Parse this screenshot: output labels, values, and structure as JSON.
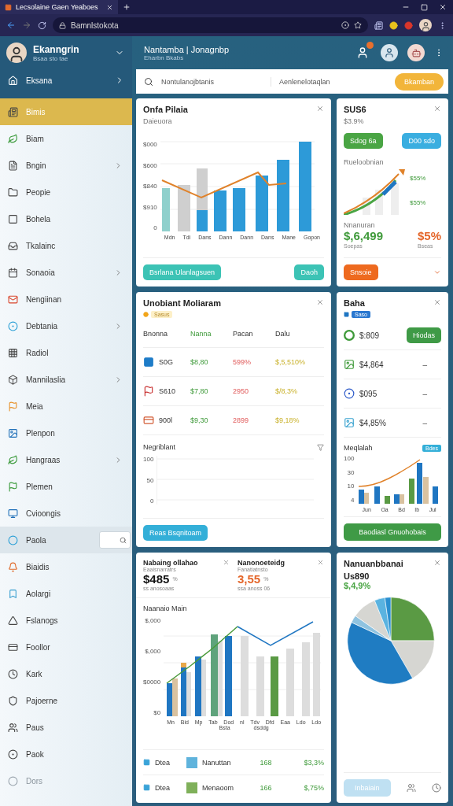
{
  "browser": {
    "tab_title": "Lecsolaine Gaen Yeaboes",
    "address": "Bamnlstokota"
  },
  "profile": {
    "name": "Ekanngrin",
    "subtitle": "Bsaa sto tae"
  },
  "sidebar": {
    "top_item": {
      "label": "Eksana",
      "expandable": true
    },
    "items": [
      {
        "label": "Bimis",
        "expandable": false,
        "selected": true
      },
      {
        "label": "Biam",
        "expandable": false,
        "selected": false
      },
      {
        "label": "Bngin",
        "expandable": true,
        "selected": false
      },
      {
        "label": "Peopie",
        "expandable": false,
        "selected": false
      },
      {
        "label": "Bohela",
        "expandable": false,
        "selected": false
      },
      {
        "label": "Tkalainc",
        "expandable": false,
        "selected": false
      },
      {
        "label": "Sonaoia",
        "expandable": true,
        "selected": false
      },
      {
        "label": "Nengiinan",
        "expandable": false,
        "selected": false
      },
      {
        "label": "Debtania",
        "expandable": true,
        "selected": false
      },
      {
        "label": "Radiol",
        "expandable": false,
        "selected": false
      },
      {
        "label": "Mannilaslia",
        "expandable": true,
        "selected": false
      },
      {
        "label": "Meia",
        "expandable": false,
        "selected": false
      },
      {
        "label": "Plenpon",
        "expandable": false,
        "selected": false
      },
      {
        "label": "Hangraas",
        "expandable": true,
        "selected": false
      },
      {
        "label": "Plemen",
        "expandable": false,
        "selected": false
      },
      {
        "label": "Cvioongis",
        "expandable": false,
        "selected": false
      },
      {
        "label": "Paola",
        "expandable": false,
        "selected": false,
        "hovered": true
      },
      {
        "label": "Biaidis",
        "expandable": false,
        "selected": false
      },
      {
        "label": "Aolargi",
        "expandable": false,
        "selected": false
      },
      {
        "label": "Fslanogs",
        "expandable": false,
        "selected": false
      },
      {
        "label": "Foollor",
        "expandable": false,
        "selected": false
      },
      {
        "label": "Kark",
        "expandable": false,
        "selected": false
      },
      {
        "label": "Pajoerne",
        "expandable": false,
        "selected": false
      },
      {
        "label": "Paus",
        "expandable": false,
        "selected": false
      },
      {
        "label": "Paok",
        "expandable": false,
        "selected": false
      },
      {
        "label": "Dors",
        "expandable": false,
        "selected": false,
        "disabled": true
      }
    ]
  },
  "header": {
    "title": "Nantamba | Jonagnbp",
    "subtitle": "Eharbn Bkabs"
  },
  "search": {
    "placeholder": "Nontulanojbtanis",
    "filter_placeholder": "Aenlenelotaqlan",
    "button": "Bkamban"
  },
  "sales_card": {
    "title": "Onfa Pilaia",
    "subtitle": "Daieuora",
    "y_labels": [
      "$000",
      "$600",
      "$840",
      "$910",
      "0"
    ],
    "x_labels": [
      "Mdn",
      "Tdi",
      "Dans",
      "Dann",
      "Dann",
      "Dans",
      "Mane",
      "Gopon"
    ],
    "buttons": [
      "Bsrlana Ulanlagsuen",
      "Daoh"
    ]
  },
  "growth_card": {
    "title": "SUS6",
    "subtitle": "$3.9%",
    "buttons": [
      "Sdog 6a",
      "D00 sdo"
    ],
    "chart_title": "Rueloobnian",
    "legend": [
      "$55%",
      "$55%"
    ],
    "stat_title": "Nnanuran",
    "stats": [
      {
        "value": "$,6,499",
        "caption": "Soepas",
        "kind": "up"
      },
      {
        "value": "$5%",
        "caption": "Bseas",
        "kind": "down"
      }
    ],
    "button": "Snsoie"
  },
  "table_card": {
    "title": "Unobiant Moliaram",
    "badge": "Sasus",
    "columns": [
      "Bnonna",
      "Nanna",
      "Pacan",
      "Dalu"
    ],
    "rows": [
      {
        "cells": [
          "S0G",
          "$8,80",
          "599%",
          "$,5,510%"
        ]
      },
      {
        "cells": [
          "S610",
          "$7,80",
          "2950",
          "$/8,3%"
        ]
      },
      {
        "cells": [
          "900l",
          "$9,30",
          "2899",
          "$9,18%"
        ]
      }
    ],
    "section_title": "Negriblant",
    "y_labels": [
      "100",
      "50",
      "0"
    ],
    "button": "Reas Bsqnitoam"
  },
  "list_card": {
    "title": "Baha",
    "badge": "Saso",
    "items": [
      {
        "value": "$:809",
        "action": "Hiodas"
      },
      {
        "value": "$4,864",
        "action": "–"
      },
      {
        "value": "$095",
        "action": "–"
      },
      {
        "value": "$4,85%",
        "action": "–"
      }
    ],
    "chart_title": "Meqlalah",
    "chart_badge": "Bdes",
    "y_labels": [
      "100",
      "30",
      "10",
      "4"
    ],
    "x_labels": [
      "Jun",
      "Oa",
      "Bd",
      "Ib",
      "Jul"
    ],
    "button": "Baodiasl Gnuohobais"
  },
  "revenue_card": {
    "stats": [
      {
        "title": "Nabaing ollahao",
        "subtitle": "Eaaisnarratrs",
        "value": "$485",
        "unit": "%",
        "note": "ss anosoaas",
        "kind": "neutral"
      },
      {
        "title": "Nanonoeteidg",
        "subtitle": "Fanatiatnsto",
        "value": "3,55",
        "unit": "%",
        "note": "ssa anoss 06",
        "kind": "down"
      }
    ],
    "chart_title": "Naanaio Main",
    "y_labels": [
      "$,000",
      "$,000",
      "$0000",
      "$0"
    ],
    "x_labels": [
      "Mn",
      "Bid",
      "Mp",
      "Tab",
      "Dod",
      "nl",
      "Tdv",
      "Dfd",
      "Eaa",
      "Ldo",
      "Ldo"
    ],
    "x_sublabels": [
      "Bsta",
      "dsddg"
    ],
    "legend": [
      {
        "tag": "Dtea",
        "name": "Nanuttan",
        "count": "168",
        "share": "$3,3%",
        "color": "#5fb3dc"
      },
      {
        "tag": "Dtea",
        "name": "Menaoom",
        "count": "166",
        "share": "$,75%",
        "color": "#7fb05a"
      }
    ]
  },
  "pie_card": {
    "title": "Nanuanbbanai",
    "subtitle": "Us890",
    "value": "$,4,9%",
    "button": "Inbaiain"
  }
}
